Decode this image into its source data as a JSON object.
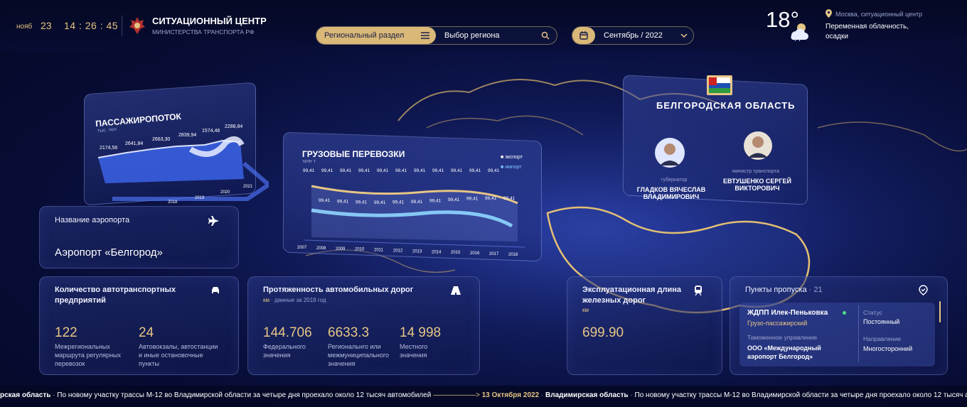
{
  "header": {
    "month": "нояб",
    "day": "23",
    "time": "14 : 26 : 45",
    "title": "СИТУАЦИОННЫЙ ЦЕНТР",
    "subtitle": "МИНИСТЕРСТВА ТРАНСПОРТА РФ",
    "section_label": "Региональный раздел",
    "region_select": "Выбор региона",
    "period": "Сентябрь / 2022",
    "weather": {
      "temp": "18°",
      "location": "Москва, ситуационный центр",
      "desc1": "Переменная облачность,",
      "desc2": "осадки"
    }
  },
  "passenger": {
    "title": "ПАССАЖИРОПОТОК",
    "unit": "тыс. чел",
    "values": [
      "2174,56",
      "2641,84",
      "2663,30",
      "2839,94",
      "1574,46",
      "2288,84"
    ],
    "years": [
      "2018",
      "2019",
      "2020",
      "2021"
    ]
  },
  "cargo": {
    "title": "ГРУЗОВЫЕ ПЕРЕВОЗКИ",
    "unit": "млн т",
    "legend_export": "экспорт",
    "legend_import": "импорт",
    "value_label": "99,41",
    "years": [
      "2007",
      "2008",
      "2009",
      "2010",
      "2011",
      "2012",
      "2013",
      "2014",
      "2015",
      "2016",
      "2017",
      "2018"
    ]
  },
  "region": {
    "name": "БЕЛГОРОДСКАЯ ОБЛАСТЬ",
    "governor_role": "губернатор",
    "governor_name1": "ГЛАДКОВ ВЯЧЕСЛАВ",
    "governor_name2": "ВЛАДИМИРОВИЧ",
    "minister_role": "министр транспорта",
    "minister_name1": "ЕВТУШЕНКО СЕРГЕЙ",
    "minister_name2": "ВИКТОРОВИЧ"
  },
  "airport": {
    "label": "Название аэропорта",
    "name": "Аэропорт «Белгород»"
  },
  "enterprises": {
    "title1": "Количество автотранспортных",
    "title2": "предприятий",
    "v1": "122",
    "d1a": "Межрегиональных",
    "d1b": "маршрута регулярных",
    "d1c": "перевозок",
    "v2": "24",
    "d2a": "Автовокзалы, автостанции",
    "d2b": "и иные остановочные",
    "d2c": "пункты"
  },
  "roads": {
    "title": "Протяженность автомобильных дорог",
    "unit": "км",
    "note": "· данные за 2019 год",
    "v1": "144.706",
    "d1a": "Федерального",
    "d1b": "значения",
    "v2": "6633.3",
    "d2a": "Региональнго или",
    "d2b": "межмуниципального",
    "d2c": "значения",
    "v3": "14 998",
    "d3a": "Местного",
    "d3b": "значения"
  },
  "rail": {
    "title1": "Эксплуатационная длина",
    "title2": "железных дорог",
    "unit": "км",
    "value": "699.90"
  },
  "checkpoints": {
    "title": "Пункты пропуска",
    "count": "· 21",
    "name": "ЖДПП Илек-Пеньковка",
    "type": "Грузо-пассажирский",
    "status_label": "Статус",
    "status": "Постоянный",
    "customs_label": "Таможенное управление",
    "customs1": "ООО «Международный",
    "customs2": "аэропорт Белгород»",
    "direction_label": "Направление",
    "direction": "Многосторонний"
  },
  "ticker": {
    "region_a": "рская область",
    "text_a": "По новому участку трассы М-12 во Владимирской области за четыре дня проехало около 12 тысяч автомобилей",
    "date": "13 Октября 2022",
    "region_b": "Владимирская область",
    "text_b": "По новому участку трассы М-12 во Владимирской области за четыре дня проехало около 12 тысяч автомобилей"
  }
}
